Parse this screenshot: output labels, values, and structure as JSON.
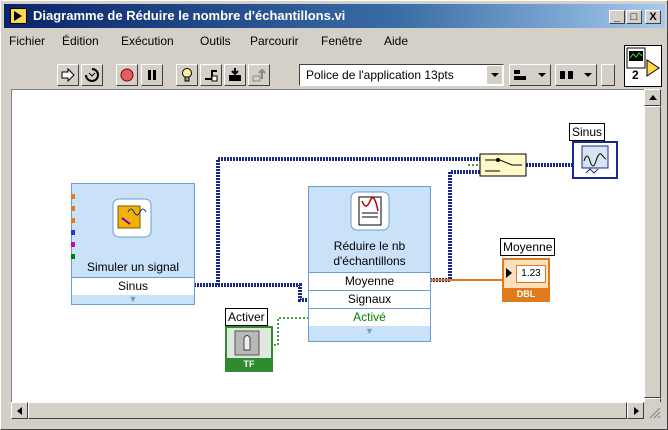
{
  "window": {
    "title": "Diagramme de Réduire le nombre d'échantillons.vi",
    "minimize": "_",
    "maximize": "□",
    "close": "X"
  },
  "menu": [
    {
      "label": "Fichier"
    },
    {
      "label": "Édition"
    },
    {
      "label": "Exécution"
    },
    {
      "label": "Outils"
    },
    {
      "label": "Parcourir"
    },
    {
      "label": "Fenêtre"
    },
    {
      "label": "Aide"
    }
  ],
  "toolbar": {
    "font_select": "Police de l'application 13pts",
    "icons": [
      "run-arrow-icon",
      "run-continuous-icon",
      "abort-icon",
      "pause-icon",
      "highlight-execution-icon",
      "retain-wire-values-icon",
      "step-into-icon",
      "step-out-icon"
    ]
  },
  "vi_icon": {
    "number": "2"
  },
  "diagram": {
    "simulate": {
      "title": "Simuler un signal",
      "terminal": "Sinus"
    },
    "reduce": {
      "title_line1": "Réduire le nb",
      "title_line2": "d'échantillons",
      "terminals": [
        "Moyenne",
        "Signaux",
        "Activé"
      ]
    },
    "enable_control": {
      "label": "Activer",
      "type": "TF"
    },
    "sinus_indicator": {
      "label": "Sinus"
    },
    "mean_indicator": {
      "label": "Moyenne",
      "value": "1.23",
      "type": "DBL"
    }
  },
  "colors": {
    "title_start": "#0a246a",
    "wire_waveform": "#1a2a8a",
    "wire_dbl": "#e07a1a",
    "wire_bool": "#008000",
    "node_fill": "#c9e2f7",
    "bool_green": "#2e8b2e"
  }
}
